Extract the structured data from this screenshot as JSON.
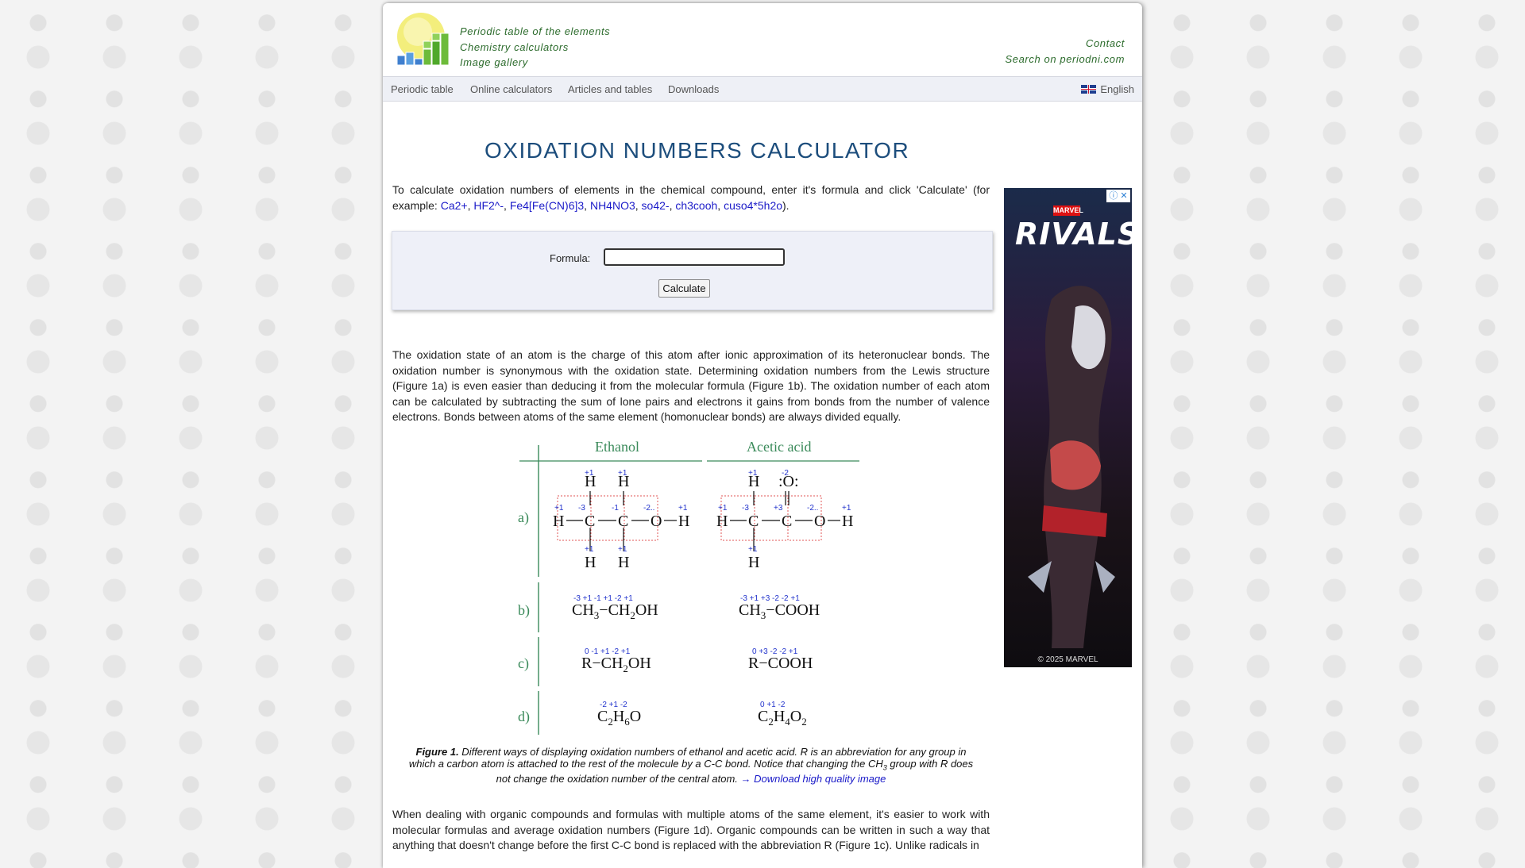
{
  "header": {
    "links": [
      "Periodic table of the elements",
      "Chemistry calculators",
      "Image gallery"
    ],
    "right_links": [
      "Contact",
      "Search on periodni.com"
    ]
  },
  "nav": {
    "items": [
      "Periodic table",
      "Online calculators",
      "Articles and tables",
      "Downloads"
    ],
    "language": "English"
  },
  "page_title": "OXIDATION NUMBERS CALCULATOR",
  "intro": {
    "text_before": "To calculate oxidation numbers of elements in the chemical compound, enter it's formula and click 'Calculate' (for example: ",
    "examples": [
      "Ca2+",
      "HF2^-",
      "Fe4[Fe(CN)6]3",
      "NH4NO3",
      "so42-",
      "ch3cooh",
      "cuso4*5h2o"
    ],
    "separator": ", ",
    "text_after": ")."
  },
  "form": {
    "label": "Formula:",
    "value": "",
    "button": "Calculate"
  },
  "paragraph1": "The oxidation state of an atom is the charge of this atom after ionic approximation of its heteronuclear bonds. The oxidation number is synonymous with the oxidation state. Determining oxidation numbers from the Lewis structure (Figure 1a) is even easier than deducing it from the molecular formula (Figure 1b). The oxidation number of each atom can be calculated by subtracting the sum of lone pairs and electrons it gains from bonds from the number of valence electrons. Bonds between atoms of the same element (homonuclear bonds) are always divided equally.",
  "figure": {
    "col1": "Ethanol",
    "col2": "Acetic acid",
    "rows": [
      "a)",
      "b)",
      "c)",
      "d)"
    ],
    "ethanol_b": [
      "CH",
      "3",
      "−CH",
      "2",
      "OH"
    ],
    "acetic_b": [
      "CH",
      "3",
      "−COOH"
    ],
    "ethanol_c": [
      "R−CH",
      "2",
      "OH"
    ],
    "acetic_c": [
      "R−COOH"
    ],
    "ethanol_d": [
      "C",
      "2",
      "H",
      "6",
      "O"
    ],
    "acetic_d": [
      "C",
      "2",
      "H",
      "4",
      "O",
      "2"
    ],
    "ox_eth_b": "-3 +1      -1 +1   -2 +1",
    "ox_ace_b": "-3 +1      +3 -2  -2 +1",
    "ox_eth_c": "0       -1 +1   -2 +1",
    "ox_ace_c": "0       +3 -2  -2 +1",
    "ox_eth_d": "-2   +1   -2",
    "ox_ace_d": "0    +1   -2"
  },
  "caption": {
    "label": "Figure 1.",
    "text": " Different ways of displaying oxidation numbers of ethanol and acetic acid. R is an abbreviation for any group in which a carbon atom is attached to the rest of the molecule by a C-C bond. Notice that changing the CH",
    "sub": "3",
    "text2": " group with R does not change the oxidation number of the central atom. ",
    "link": "→ Download high quality image"
  },
  "paragraph2": "When dealing with organic compounds and formulas with multiple atoms of the same element, it's easier to work with molecular formulas and average oxidation numbers (Figure 1d). Organic compounds can be written in such a way that anything that doesn't change before the first C-C bond is replaced with the abbreviation R (Figure 1c). Unlike radicals in",
  "ad": {
    "brand": "MARVEL",
    "title": "RIVALS",
    "footer": "© 2025 MARVEL"
  },
  "colors": {
    "title": "#1c4d7c",
    "link": "#1a1ac8",
    "header_link": "#2c6b2c",
    "figure_green": "#3a8a5a",
    "ox_blue": "#2233cc",
    "box_red": "#e05555"
  }
}
